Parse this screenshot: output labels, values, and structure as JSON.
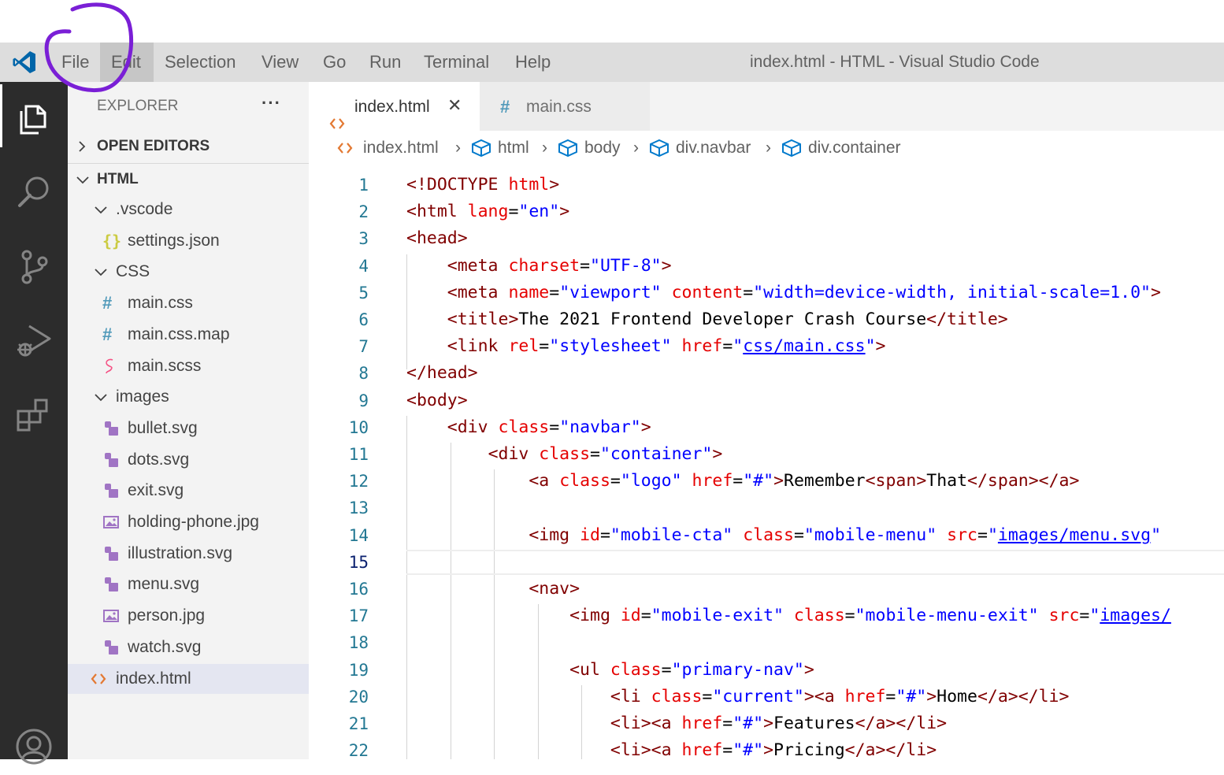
{
  "menu": {
    "items": [
      "File",
      "Edit",
      "Selection",
      "View",
      "Go",
      "Run",
      "Terminal",
      "Help"
    ],
    "window_title": "index.html - HTML - Visual Studio Code"
  },
  "activity_bar": {
    "icons": [
      "files-icon",
      "search-icon",
      "source-control-icon",
      "run-debug-icon",
      "extensions-icon",
      "account-icon"
    ]
  },
  "explorer": {
    "title": "EXPLORER",
    "more": "···",
    "sections": {
      "open_editors": "OPEN EDITORS",
      "folder": "HTML"
    },
    "tree": [
      {
        "label": ".vscode",
        "type": "folder",
        "depth": 1
      },
      {
        "label": "settings.json",
        "type": "json",
        "depth": 2
      },
      {
        "label": "CSS",
        "type": "folder",
        "depth": 1
      },
      {
        "label": "main.css",
        "type": "css",
        "depth": 2
      },
      {
        "label": "main.css.map",
        "type": "css",
        "depth": 2
      },
      {
        "label": "main.scss",
        "type": "scss",
        "depth": 2
      },
      {
        "label": "images",
        "type": "folder",
        "depth": 1
      },
      {
        "label": "bullet.svg",
        "type": "svg",
        "depth": 2
      },
      {
        "label": "dots.svg",
        "type": "svg",
        "depth": 2
      },
      {
        "label": "exit.svg",
        "type": "svg",
        "depth": 2
      },
      {
        "label": "holding-phone.jpg",
        "type": "img",
        "depth": 2
      },
      {
        "label": "illustration.svg",
        "type": "svg",
        "depth": 2
      },
      {
        "label": "menu.svg",
        "type": "svg",
        "depth": 2
      },
      {
        "label": "person.jpg",
        "type": "img",
        "depth": 2
      },
      {
        "label": "watch.svg",
        "type": "svg",
        "depth": 2
      },
      {
        "label": "index.html",
        "type": "html",
        "depth": 1,
        "selected": true
      }
    ]
  },
  "tabs": [
    {
      "label": "index.html",
      "icon": "html-icon",
      "active": true,
      "close": "✕"
    },
    {
      "label": "main.css",
      "icon": "hash-icon",
      "active": false
    }
  ],
  "breadcrumbs": [
    "index.html",
    "html",
    "body",
    "div.navbar",
    "div.container"
  ],
  "code": {
    "line_numbers": [
      "1",
      "2",
      "3",
      "4",
      "5",
      "6",
      "7",
      "8",
      "9",
      "10",
      "11",
      "12",
      "13",
      "14",
      "15",
      "16",
      "17",
      "18",
      "19",
      "20",
      "21",
      "22"
    ],
    "current_line": "15",
    "lines": [
      [
        [
          "t",
          "<!DOCTYPE "
        ],
        [
          "a",
          "html"
        ],
        [
          "t",
          ">"
        ]
      ],
      [
        [
          "t",
          "<html "
        ],
        [
          "a",
          "lang"
        ],
        [
          "p",
          "="
        ],
        [
          "s",
          "\"en\""
        ],
        [
          "t",
          ">"
        ]
      ],
      [
        [
          "t",
          "<head>"
        ]
      ],
      [
        [
          "p",
          "    "
        ],
        [
          "t",
          "<meta "
        ],
        [
          "a",
          "charset"
        ],
        [
          "p",
          "="
        ],
        [
          "s",
          "\"UTF-8\""
        ],
        [
          "t",
          ">"
        ]
      ],
      [
        [
          "p",
          "    "
        ],
        [
          "t",
          "<meta "
        ],
        [
          "a",
          "name"
        ],
        [
          "p",
          "="
        ],
        [
          "s",
          "\"viewport\""
        ],
        [
          "p",
          " "
        ],
        [
          "a",
          "content"
        ],
        [
          "p",
          "="
        ],
        [
          "s",
          "\"width=device-width, initial-scale=1.0\""
        ],
        [
          "t",
          ">"
        ]
      ],
      [
        [
          "p",
          "    "
        ],
        [
          "t",
          "<title>"
        ],
        [
          "p",
          "The 2021 Frontend Developer Crash Course"
        ],
        [
          "t",
          "</title>"
        ]
      ],
      [
        [
          "p",
          "    "
        ],
        [
          "t",
          "<link "
        ],
        [
          "a",
          "rel"
        ],
        [
          "p",
          "="
        ],
        [
          "s",
          "\"stylesheet\""
        ],
        [
          "p",
          " "
        ],
        [
          "a",
          "href"
        ],
        [
          "p",
          "="
        ],
        [
          "s",
          "\""
        ],
        [
          "su",
          "css/main.css"
        ],
        [
          "s",
          "\""
        ],
        [
          "t",
          ">"
        ]
      ],
      [
        [
          "t",
          "</head>"
        ]
      ],
      [
        [
          "t",
          "<body>"
        ]
      ],
      [
        [
          "p",
          "    "
        ],
        [
          "t",
          "<div "
        ],
        [
          "a",
          "class"
        ],
        [
          "p",
          "="
        ],
        [
          "s",
          "\"navbar\""
        ],
        [
          "t",
          ">"
        ]
      ],
      [
        [
          "p",
          "        "
        ],
        [
          "t",
          "<div "
        ],
        [
          "a",
          "class"
        ],
        [
          "p",
          "="
        ],
        [
          "s",
          "\"container\""
        ],
        [
          "t",
          ">"
        ]
      ],
      [
        [
          "p",
          "            "
        ],
        [
          "t",
          "<a "
        ],
        [
          "a",
          "class"
        ],
        [
          "p",
          "="
        ],
        [
          "s",
          "\"logo\""
        ],
        [
          "p",
          " "
        ],
        [
          "a",
          "href"
        ],
        [
          "p",
          "="
        ],
        [
          "s",
          "\"#\""
        ],
        [
          "t",
          ">"
        ],
        [
          "p",
          "Remember"
        ],
        [
          "t",
          "<span>"
        ],
        [
          "p",
          "That"
        ],
        [
          "t",
          "</span></a>"
        ]
      ],
      [],
      [
        [
          "p",
          "            "
        ],
        [
          "t",
          "<img "
        ],
        [
          "a",
          "id"
        ],
        [
          "p",
          "="
        ],
        [
          "s",
          "\"mobile-cta\""
        ],
        [
          "p",
          " "
        ],
        [
          "a",
          "class"
        ],
        [
          "p",
          "="
        ],
        [
          "s",
          "\"mobile-menu\""
        ],
        [
          "p",
          " "
        ],
        [
          "a",
          "src"
        ],
        [
          "p",
          "="
        ],
        [
          "s",
          "\""
        ],
        [
          "su",
          "images/menu.svg"
        ],
        [
          "s",
          "\""
        ]
      ],
      [],
      [
        [
          "p",
          "            "
        ],
        [
          "t",
          "<nav>"
        ]
      ],
      [
        [
          "p",
          "                "
        ],
        [
          "t",
          "<img "
        ],
        [
          "a",
          "id"
        ],
        [
          "p",
          "="
        ],
        [
          "s",
          "\"mobile-exit\""
        ],
        [
          "p",
          " "
        ],
        [
          "a",
          "class"
        ],
        [
          "p",
          "="
        ],
        [
          "s",
          "\"mobile-menu-exit\""
        ],
        [
          "p",
          " "
        ],
        [
          "a",
          "src"
        ],
        [
          "p",
          "="
        ],
        [
          "s",
          "\""
        ],
        [
          "su",
          "images/"
        ]
      ],
      [],
      [
        [
          "p",
          "                "
        ],
        [
          "t",
          "<ul "
        ],
        [
          "a",
          "class"
        ],
        [
          "p",
          "="
        ],
        [
          "s",
          "\"primary-nav\""
        ],
        [
          "t",
          ">"
        ]
      ],
      [
        [
          "p",
          "                    "
        ],
        [
          "t",
          "<li "
        ],
        [
          "a",
          "class"
        ],
        [
          "p",
          "="
        ],
        [
          "s",
          "\"current\""
        ],
        [
          "t",
          "><a "
        ],
        [
          "a",
          "href"
        ],
        [
          "p",
          "="
        ],
        [
          "s",
          "\"#\""
        ],
        [
          "t",
          ">"
        ],
        [
          "p",
          "Home"
        ],
        [
          "t",
          "</a></li>"
        ]
      ],
      [
        [
          "p",
          "                    "
        ],
        [
          "t",
          "<li><a "
        ],
        [
          "a",
          "href"
        ],
        [
          "p",
          "="
        ],
        [
          "s",
          "\"#\""
        ],
        [
          "t",
          ">"
        ],
        [
          "p",
          "Features"
        ],
        [
          "t",
          "</a></li>"
        ]
      ],
      [
        [
          "p",
          "                    "
        ],
        [
          "t",
          "<li><a "
        ],
        [
          "a",
          "href"
        ],
        [
          "p",
          "="
        ],
        [
          "s",
          "\"#\""
        ],
        [
          "t",
          ">"
        ],
        [
          "p",
          "Pricing"
        ],
        [
          "t",
          "</a></li>"
        ]
      ]
    ]
  },
  "colors": {
    "tag": "#800000",
    "attribute": "#e50000",
    "string": "#0000ff",
    "line_number": "#237893",
    "annotation": "#7a1fd6",
    "vscode_blue": "#0065a9"
  }
}
